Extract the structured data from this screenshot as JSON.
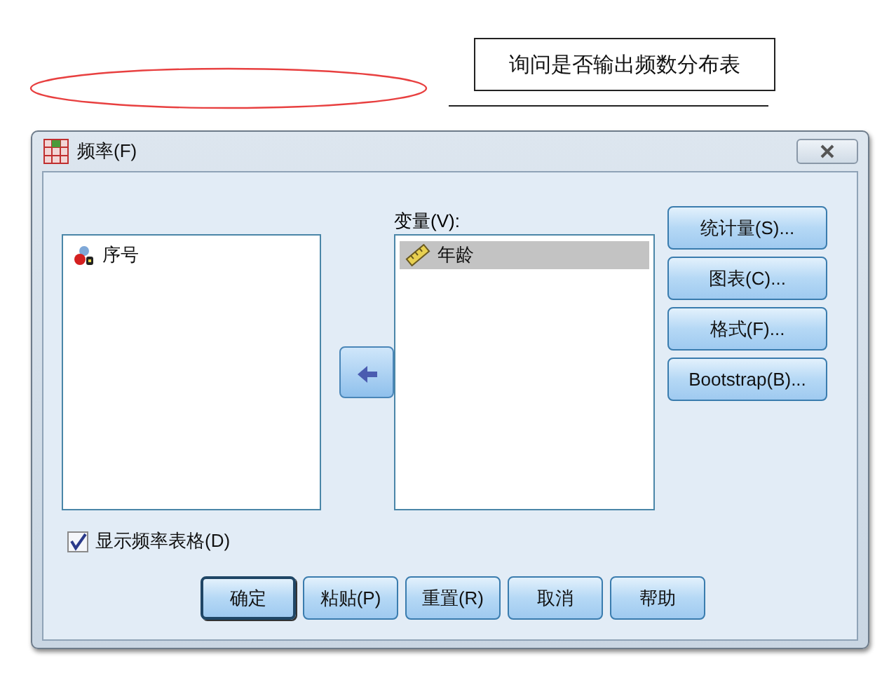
{
  "slide": {
    "callout": "询问是否输出频数分布表"
  },
  "dialog": {
    "title": "频率(F)",
    "source_list": {
      "items": [
        {
          "label": "序号",
          "kind": "nominal",
          "selected": false
        }
      ]
    },
    "variables_label": "变量(V):",
    "variables_list": {
      "items": [
        {
          "label": "年龄",
          "kind": "scale",
          "selected": true
        }
      ]
    },
    "side_buttons": [
      {
        "label": "统计量(S)..."
      },
      {
        "label": "图表(C)..."
      },
      {
        "label": "格式(F)..."
      },
      {
        "label": "Bootstrap(B)..."
      }
    ],
    "display_table": {
      "label": "显示频率表格(D)",
      "checked": true
    },
    "buttons": [
      {
        "label": "确定",
        "default": true
      },
      {
        "label": "粘贴(P)",
        "default": false
      },
      {
        "label": "重置(R)",
        "default": false
      },
      {
        "label": "取消",
        "default": false
      },
      {
        "label": "帮助",
        "default": false
      }
    ]
  }
}
